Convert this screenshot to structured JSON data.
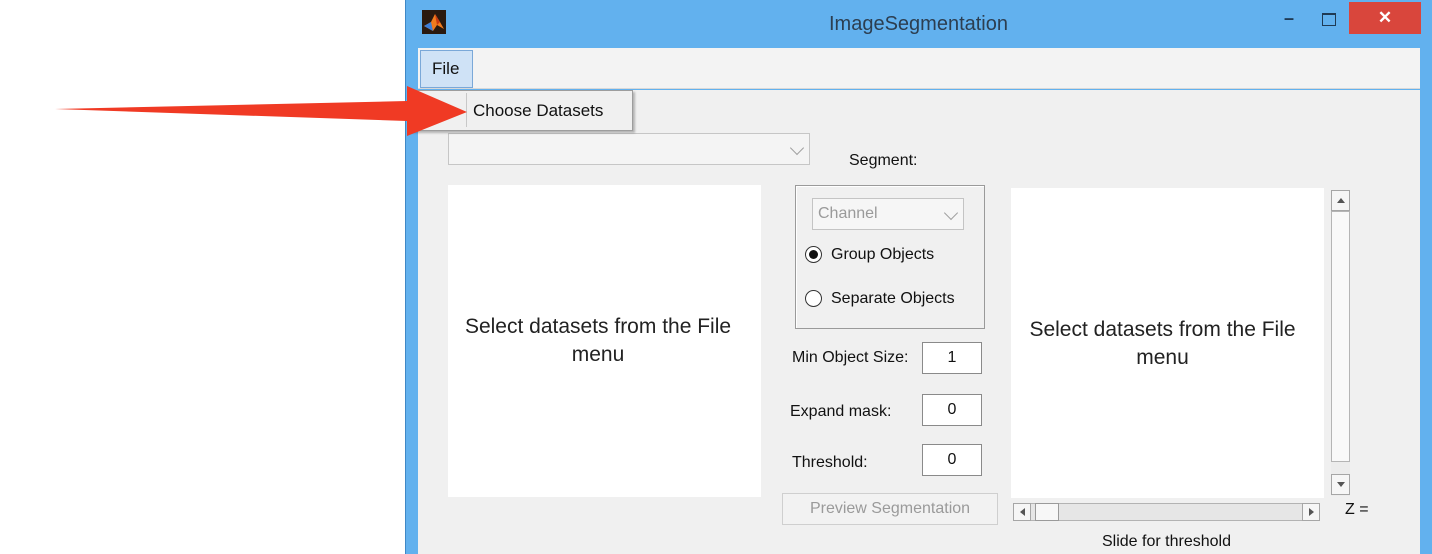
{
  "window": {
    "title": "ImageSegmentation",
    "minimize_glyph": "–",
    "close_glyph": "✕",
    "app_icon": "matlab-logo-icon"
  },
  "menu": {
    "file_label": "File",
    "file_items": [
      "Choose Datasets"
    ]
  },
  "controls": {
    "dataset_select_value": "",
    "segment_label": "Segment:",
    "channel_select_value": "Channel",
    "radio_group_label": "Group Objects",
    "radio_separate_label": "Separate Objects",
    "selected_radio": "Group Objects",
    "min_object_size_label": "Min Object Size:",
    "min_object_size_value": "1",
    "expand_mask_label": "Expand mask:",
    "expand_mask_value": "0",
    "threshold_label": "Threshold:",
    "threshold_value": "0",
    "preview_button_label": "Preview Segmentation",
    "z_label": "Z =",
    "slider_caption": "Slide for threshold"
  },
  "axes": {
    "left_message": "Select datasets from the File menu",
    "right_message": "Select datasets from the File menu"
  },
  "annotation": {
    "arrow_color": "#f03a24",
    "points_to": "Choose Datasets"
  },
  "colors": {
    "titlebar": "#62b1ee",
    "close_button": "#d9463c",
    "client_bg": "#f0f0f0"
  }
}
